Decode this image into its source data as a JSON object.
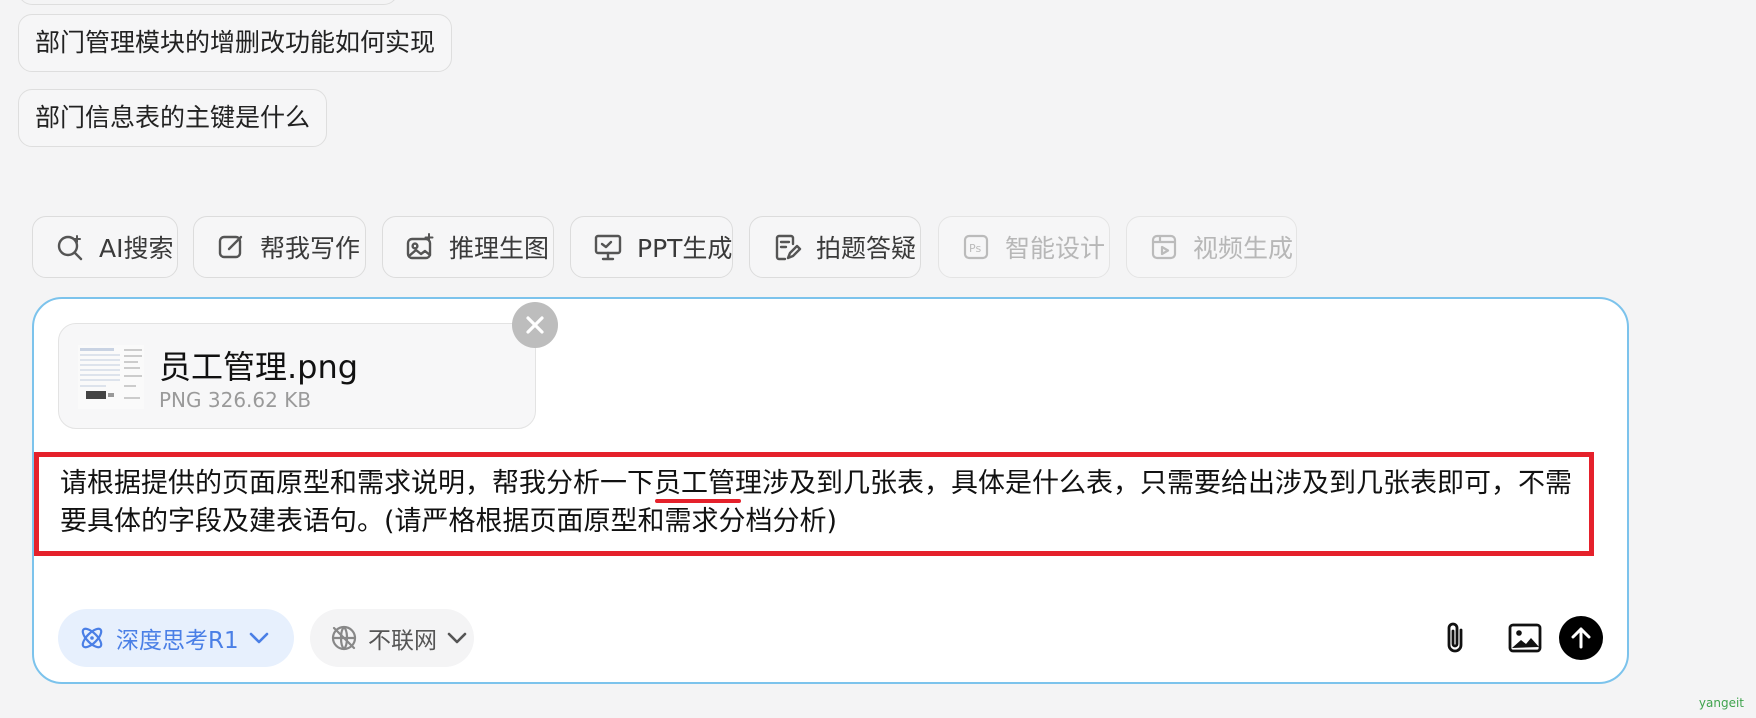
{
  "suggestions": [
    {
      "label": "部门管理模块的增删改功能如何实现"
    },
    {
      "label": "部门信息表的主键是什么"
    }
  ],
  "quick_actions": [
    {
      "label": "AI搜索",
      "icon": "ai-search-icon",
      "enabled": true
    },
    {
      "label": "帮我写作",
      "icon": "edit-icon",
      "enabled": true
    },
    {
      "label": "推理生图",
      "icon": "image-generate-icon",
      "enabled": true
    },
    {
      "label": "PPT生成",
      "icon": "presentation-icon",
      "enabled": true
    },
    {
      "label": "拍题答疑",
      "icon": "document-edit-icon",
      "enabled": true
    },
    {
      "label": "智能设计",
      "icon": "ps-icon",
      "enabled": false
    },
    {
      "label": "视频生成",
      "icon": "video-icon",
      "enabled": false
    }
  ],
  "attachment": {
    "name": "员工管理.png",
    "type": "PNG",
    "size": "326.62 KB",
    "meta": "PNG 326.62 KB"
  },
  "prompt": {
    "before": "请根据提供的页面原型和需求说明，帮我分析一下",
    "highlight": "员工管",
    "after": "理涉及到几张表，具体是什么表，只需要给出涉及到几张表即可，不需要具体的字段及建表语句。(请严格根据页面原型和需求分档分析)"
  },
  "toolbar": {
    "deep_think_label": "深度思考R1",
    "web_label": "不联网"
  },
  "colors": {
    "accent_blue": "#4a7fe6",
    "composer_border": "#7cc3ec",
    "annotation_red": "#e5212b",
    "send_button": "#000000"
  },
  "watermark": "yangeit"
}
